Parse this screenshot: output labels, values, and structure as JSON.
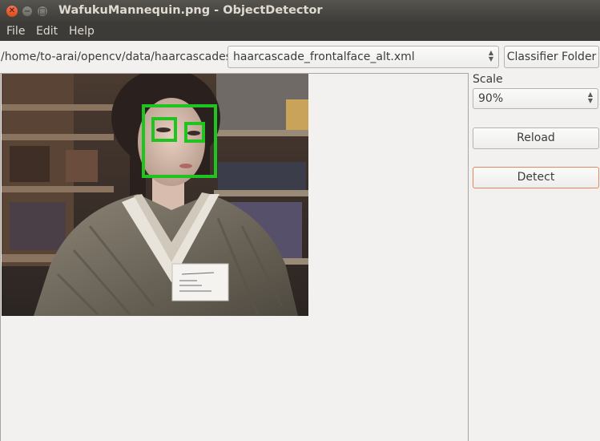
{
  "window": {
    "title": "WafukuMannequin.png - ObjectDetector"
  },
  "menu": {
    "items": [
      "File",
      "Edit",
      "Help"
    ]
  },
  "toolbar": {
    "path": "/home/to-arai/opencv/data/haarcascades",
    "classifier": "haarcascade_frontalface_alt.xml",
    "folder_button": "Classifier Folder"
  },
  "sidebar": {
    "scale_label": "Scale",
    "scale_value": "90%",
    "reload_button": "Reload",
    "detect_button": "Detect"
  },
  "colors": {
    "detection_box": "#1fc41f",
    "detect_focus": "#e4875e"
  }
}
